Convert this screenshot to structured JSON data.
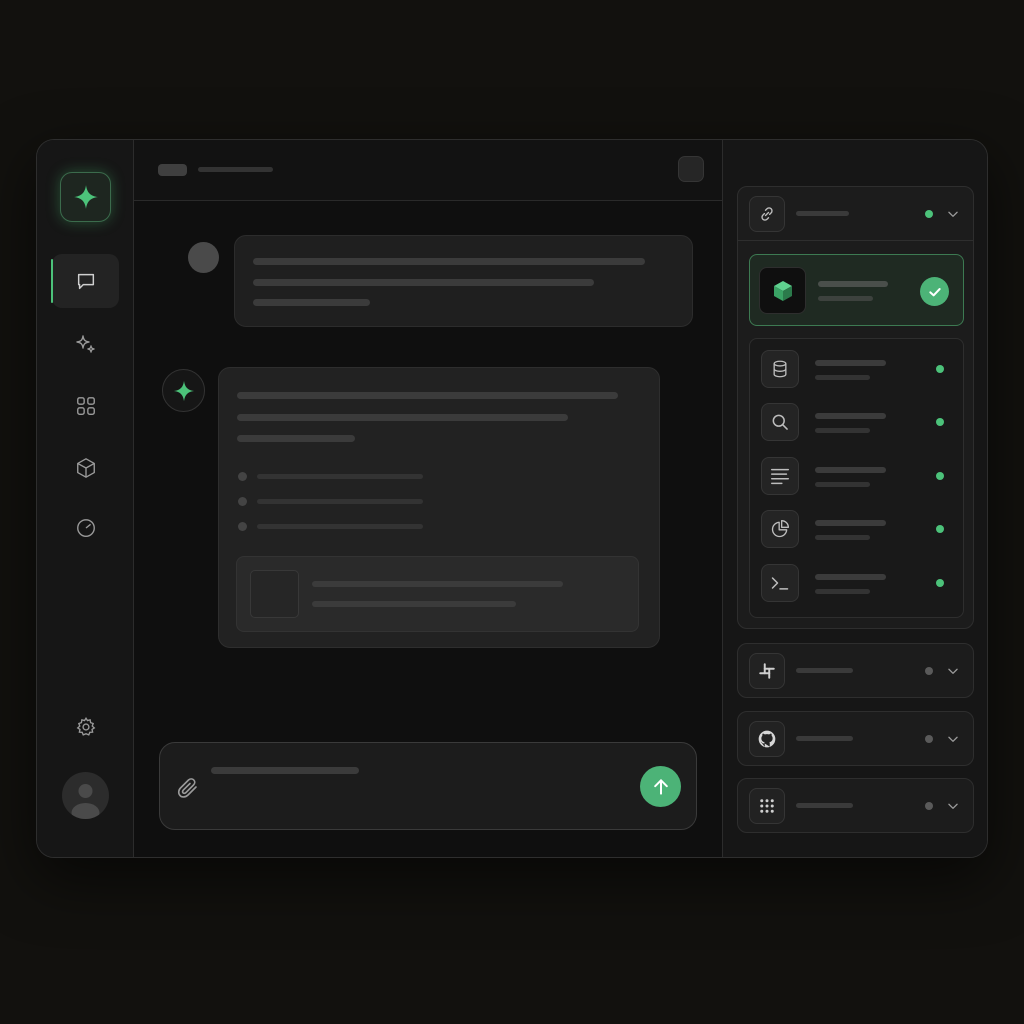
{
  "app": {
    "accent": "#4cc27a",
    "background": "#12110e"
  },
  "rail": {
    "logo_icon": "sparkle-icon",
    "items": [
      {
        "name": "chat",
        "icon": "chat-bubble-icon",
        "active": true
      },
      {
        "name": "sparkles",
        "icon": "sparkles-icon",
        "active": false
      },
      {
        "name": "apps",
        "icon": "grid-icon",
        "active": false
      },
      {
        "name": "models",
        "icon": "cube-icon",
        "active": false
      },
      {
        "name": "history",
        "icon": "clock-icon",
        "active": false
      }
    ],
    "settings_icon": "gear-icon",
    "avatar_icon": "user-avatar-icon"
  },
  "composer": {
    "attach_icon": "paperclip-icon",
    "send_icon": "arrow-up-icon"
  },
  "connections": {
    "groups": [
      {
        "name": "links",
        "icon": "link-icon",
        "status": "connected",
        "expanded": true
      },
      {
        "name": "slack",
        "icon": "slack-icon",
        "status": "disconnected",
        "expanded": false
      },
      {
        "name": "github",
        "icon": "github-icon",
        "status": "disconnected",
        "expanded": false
      },
      {
        "name": "apps",
        "icon": "dots-grid-icon",
        "status": "disconnected",
        "expanded": false
      }
    ],
    "selected": {
      "icon": "green-cube-icon",
      "checked": true
    },
    "tools": [
      {
        "icon": "database-icon",
        "status": "connected"
      },
      {
        "icon": "search-icon",
        "status": "connected"
      },
      {
        "icon": "text-lines-icon",
        "status": "connected"
      },
      {
        "icon": "pie-chart-icon",
        "status": "connected"
      },
      {
        "icon": "terminal-icon",
        "status": "connected"
      }
    ]
  }
}
